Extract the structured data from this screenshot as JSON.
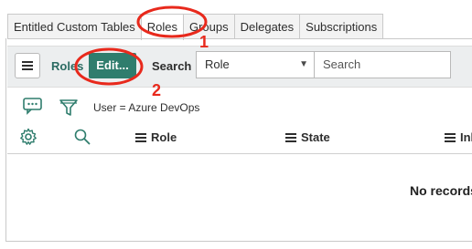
{
  "tabs": [
    {
      "label": "Entitled Custom Tables",
      "active": false
    },
    {
      "label": "Roles",
      "active": true
    },
    {
      "label": "Groups",
      "active": false
    },
    {
      "label": "Delegates",
      "active": false
    },
    {
      "label": "Subscriptions",
      "active": false
    }
  ],
  "toolbar": {
    "title": "Roles",
    "edit_label": "Edit...",
    "search_label": "Search",
    "field_select": "Role",
    "search_placeholder": "Search"
  },
  "filter": {
    "condition": "User = Azure DevOps"
  },
  "columns": [
    "Role",
    "State",
    "Inh"
  ],
  "empty_message": "No records",
  "annotations": [
    "1",
    "2"
  ],
  "colors": {
    "accent": "#2f7d6d",
    "annotation": "#e8291c",
    "toolbar_bg": "#eceeef"
  },
  "icons": [
    "menu-icon",
    "message-icon",
    "filter-icon",
    "gear-icon",
    "search-icon",
    "list-icon",
    "dropdown-caret-icon"
  ]
}
